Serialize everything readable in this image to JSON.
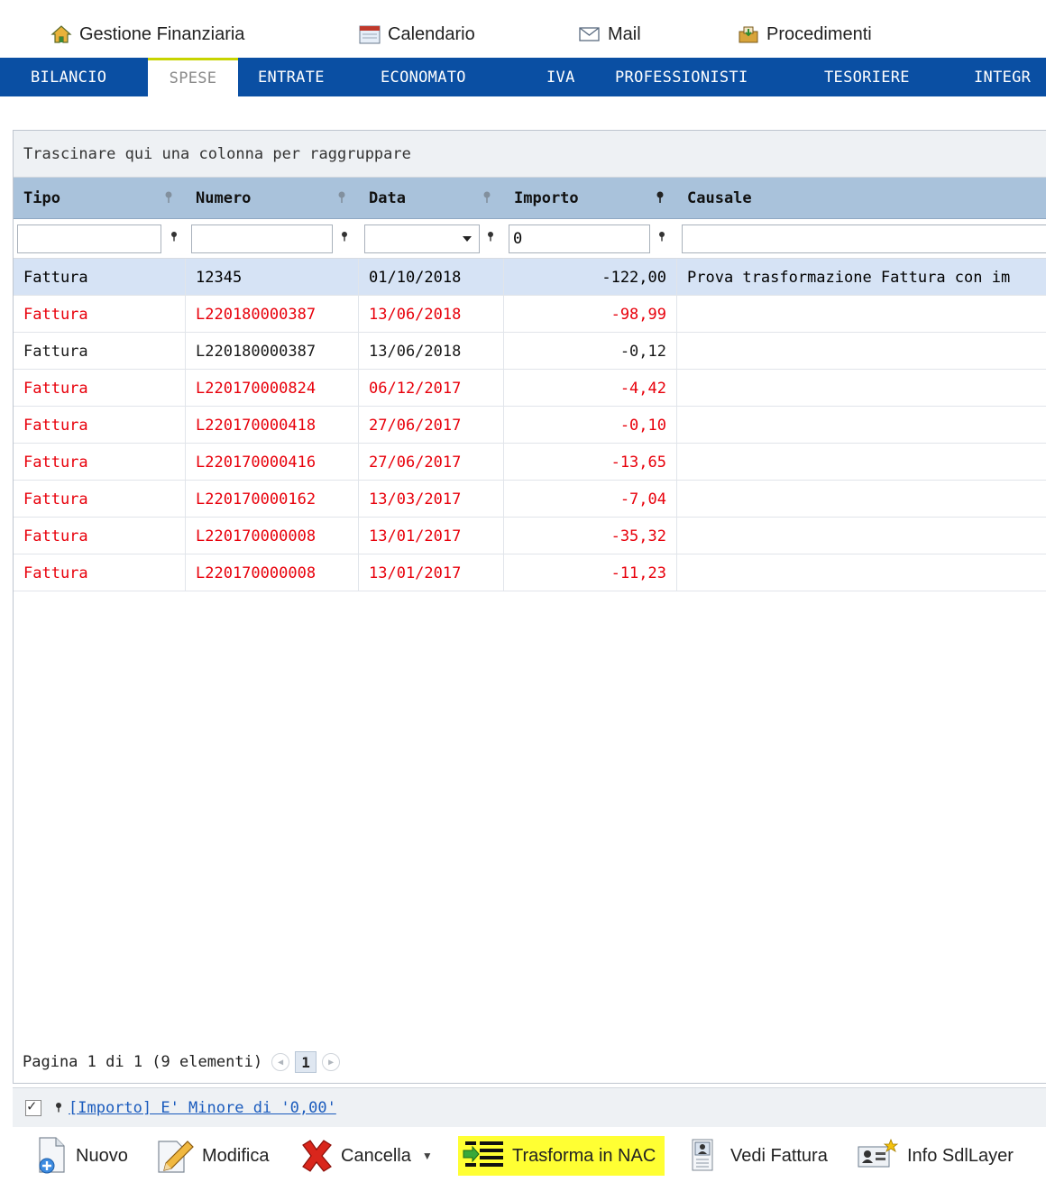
{
  "topnav": {
    "items": [
      {
        "label": "Gestione Finanziaria",
        "icon": "home-icon"
      },
      {
        "label": "Calendario",
        "icon": "calendar-icon"
      },
      {
        "label": "Mail",
        "icon": "mail-icon"
      },
      {
        "label": "Procedimenti",
        "icon": "inbox-icon"
      }
    ]
  },
  "tabs": [
    "BILANCIO",
    "SPESE",
    "ENTRATE",
    "ECONOMATO",
    "IVA",
    "PROFESSIONISTI",
    "TESORIERE",
    "INTEGR"
  ],
  "active_tab": "SPESE",
  "grid": {
    "group_hint": "Trascinare qui una colonna per raggruppare",
    "columns": [
      "Tipo",
      "Numero",
      "Data",
      "Importo",
      "Causale"
    ],
    "filters": {
      "tipo": "",
      "numero": "",
      "data": "",
      "importo": "0",
      "causale": ""
    },
    "rows": [
      {
        "tipo": "Fattura",
        "numero": "12345",
        "data": "01/10/2018",
        "importo": "-122,00",
        "causale": "Prova trasformazione Fattura con im",
        "status": "selected"
      },
      {
        "tipo": "Fattura",
        "numero": "L220180000387",
        "data": "13/06/2018",
        "importo": "-98,99",
        "causale": "",
        "status": "red"
      },
      {
        "tipo": "Fattura",
        "numero": "L220180000387",
        "data": "13/06/2018",
        "importo": "-0,12",
        "causale": "",
        "status": "black"
      },
      {
        "tipo": "Fattura",
        "numero": "L220170000824",
        "data": "06/12/2017",
        "importo": "-4,42",
        "causale": "",
        "status": "red"
      },
      {
        "tipo": "Fattura",
        "numero": "L220170000418",
        "data": "27/06/2017",
        "importo": "-0,10",
        "causale": "",
        "status": "red"
      },
      {
        "tipo": "Fattura",
        "numero": "L220170000416",
        "data": "27/06/2017",
        "importo": "-13,65",
        "causale": "",
        "status": "red"
      },
      {
        "tipo": "Fattura",
        "numero": "L220170000162",
        "data": "13/03/2017",
        "importo": "-7,04",
        "causale": "",
        "status": "red"
      },
      {
        "tipo": "Fattura",
        "numero": "L220170000008",
        "data": "13/01/2017",
        "importo": "-35,32",
        "causale": "",
        "status": "red"
      },
      {
        "tipo": "Fattura",
        "numero": "L220170000008",
        "data": "13/01/2017",
        "importo": "-11,23",
        "causale": "",
        "status": "red"
      }
    ],
    "pager": {
      "summary": "Pagina 1 di 1 (9 elementi)",
      "current_page": "1"
    },
    "active_filter": "[Importo] E' Minore di '0,00'"
  },
  "toolbar": {
    "nuovo": "Nuovo",
    "modifica": "Modifica",
    "cancella": "Cancella",
    "trasforma": "Trasforma in NAC",
    "vedi_fattura": "Vedi Fattura",
    "info_sdllayer": "Info SdlLayer"
  },
  "colors": {
    "tabbar": "#0a4fa3",
    "header": "#a9c2db",
    "selected_row": "#d6e3f5",
    "error_text": "#e8000b",
    "highlight": "#ffff33"
  }
}
